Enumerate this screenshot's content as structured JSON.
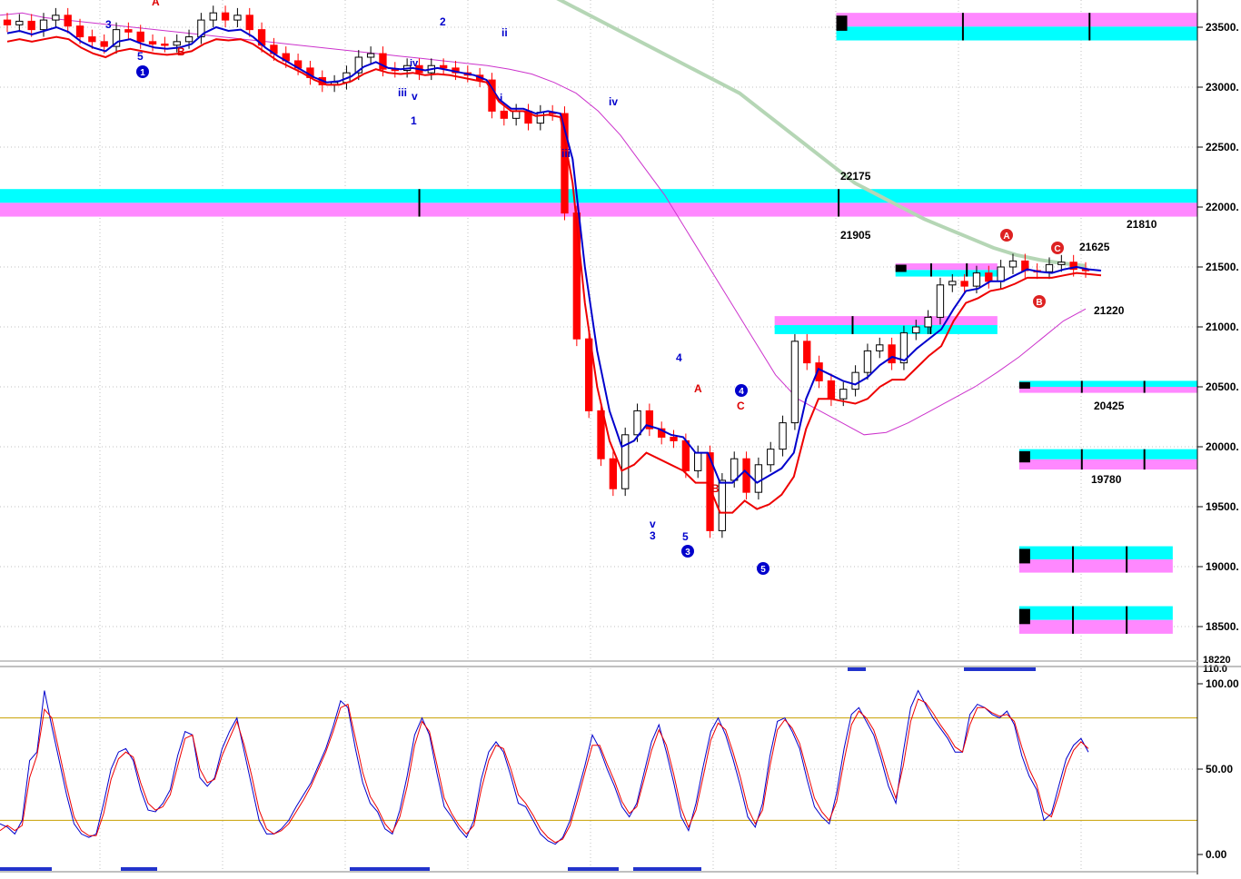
{
  "chart_data": [
    {
      "type": "candlestick",
      "ylim": [
        18220,
        23620
      ],
      "y_ticks": [
        "23500.",
        "23000.",
        "22500.",
        "22000.",
        "21500.",
        "21000.",
        "20500.",
        "20000.",
        "19500.",
        "19000.",
        "18500."
      ],
      "y_min_label": "18220",
      "grid": "dotted",
      "colors": {
        "up": "#000000",
        "down": "#ff0000",
        "blue_band": "#0000cc",
        "red_band": "#ee0000",
        "ma_slow": "#b5d6b5",
        "ma_mid": "#cc33cc",
        "cyan": "#00ffff",
        "magenta": "#ff88ff",
        "label_blue": "#0000cc",
        "label_red": "#dd0000"
      },
      "zones": [
        {
          "x0": 0.6739,
          "x1": 0.9654,
          "y_top": 23620,
          "y_bottom": 23390,
          "order": "magenta-cyan"
        },
        {
          "x0": 0.0,
          "x1": 0.9654,
          "y_top": 22150,
          "y_bottom": 21920,
          "order": "cyan-magenta"
        },
        {
          "x0": 0.7216,
          "x1": 0.8037,
          "y_top": 21530,
          "y_bottom": 21420,
          "order": "magenta-cyan"
        },
        {
          "x0": 0.6242,
          "x1": 0.8037,
          "y_top": 21090,
          "y_bottom": 20940,
          "order": "magenta-cyan"
        },
        {
          "x0": 0.8213,
          "x1": 0.9654,
          "y_top": 20550,
          "y_bottom": 20450,
          "order": "cyan-magenta"
        },
        {
          "x0": 0.8213,
          "x1": 0.9654,
          "y_top": 19980,
          "y_bottom": 19810,
          "order": "cyan-magenta"
        },
        {
          "x0": 0.8213,
          "x1": 0.945,
          "y_top": 19170,
          "y_bottom": 18950,
          "order": "cyan-magenta"
        },
        {
          "x0": 0.8213,
          "x1": 0.945,
          "y_top": 18670,
          "y_bottom": 18440,
          "order": "cyan-magenta"
        }
      ],
      "level_labels": [
        "22175",
        "21905",
        "21810",
        "21625",
        "21220",
        "20425",
        "19780"
      ],
      "wave_labels": {
        "blue_text": [
          "3",
          "5",
          "2",
          "iv",
          "v",
          "iii",
          "1",
          "ii",
          "i",
          "iv",
          "iii",
          "4",
          "v",
          "3",
          "5"
        ],
        "red_text": [
          "A",
          "B",
          "A",
          "C",
          "B"
        ],
        "blue_circles": [
          "1",
          "3",
          "4",
          "5"
        ],
        "red_circles": [
          "A",
          "C",
          "B"
        ]
      },
      "close_series": [
        23520,
        23550,
        23480,
        23560,
        23600,
        23510,
        23420,
        23380,
        23340,
        23480,
        23460,
        23380,
        23360,
        23350,
        23380,
        23420,
        23560,
        23620,
        23560,
        23600,
        23480,
        23350,
        23280,
        23220,
        23160,
        23080,
        23020,
        23040,
        23120,
        23250,
        23280,
        23150,
        23140,
        23180,
        23120,
        23180,
        23160,
        23120,
        23100,
        23060,
        22800,
        22740,
        22800,
        22700,
        22790,
        22780,
        21950,
        20900,
        20300,
        19900,
        19650,
        20100,
        20300,
        20150,
        20080,
        20050,
        19800,
        19950,
        19300,
        19720,
        19900,
        19620,
        19850,
        19980,
        20200,
        20880,
        20700,
        20550,
        20400,
        20480,
        20620,
        20800,
        20850,
        20700,
        20950,
        21000,
        21080,
        21350,
        21380,
        21340,
        21450,
        21380,
        21500,
        21550,
        21470,
        21460,
        21520,
        21540,
        21480,
        21470
      ],
      "fast_band": [
        23450,
        23470,
        23440,
        23470,
        23500,
        23460,
        23380,
        23330,
        23300,
        23380,
        23400,
        23360,
        23330,
        23320,
        23330,
        23360,
        23450,
        23500,
        23470,
        23480,
        23420,
        23330,
        23260,
        23200,
        23140,
        23080,
        23040,
        23050,
        23090,
        23170,
        23210,
        23160,
        23150,
        23160,
        23140,
        23160,
        23140,
        23120,
        23100,
        23060,
        22900,
        22820,
        22820,
        22780,
        22800,
        22780,
        22400,
        21500,
        20800,
        20300,
        20000,
        20050,
        20180,
        20150,
        20100,
        20080,
        19950,
        19950,
        19700,
        19700,
        19800,
        19700,
        19760,
        19820,
        19950,
        20400,
        20650,
        20600,
        20550,
        20520,
        20580,
        20680,
        20750,
        20720,
        20820,
        20900,
        20980,
        21150,
        21300,
        21320,
        21380,
        21380,
        21430,
        21480,
        21460,
        21450,
        21480,
        21500,
        21480,
        21470
      ],
      "slow_band": [
        23380,
        23400,
        23380,
        23400,
        23420,
        23400,
        23330,
        23280,
        23250,
        23300,
        23320,
        23300,
        23280,
        23270,
        23280,
        23300,
        23360,
        23400,
        23390,
        23400,
        23360,
        23290,
        23220,
        23170,
        23120,
        23060,
        23020,
        23020,
        23050,
        23110,
        23150,
        23120,
        23110,
        23120,
        23100,
        23110,
        23100,
        23080,
        23060,
        23040,
        22880,
        22800,
        22800,
        22760,
        22770,
        22750,
        22200,
        21200,
        20500,
        20050,
        19800,
        19850,
        19950,
        19900,
        19850,
        19800,
        19700,
        19700,
        19450,
        19450,
        19550,
        19480,
        19520,
        19600,
        19750,
        20150,
        20400,
        20400,
        20380,
        20360,
        20400,
        20500,
        20560,
        20560,
        20660,
        20760,
        20840,
        21050,
        21200,
        21240,
        21300,
        21320,
        21360,
        21410,
        21410,
        21410,
        21430,
        21450,
        21440,
        21430
      ],
      "ma_mid": [
        23600,
        23620,
        23580,
        23560,
        23540,
        23520,
        23500,
        23480,
        23460,
        23440,
        23420,
        23400,
        23380,
        23360,
        23340,
        23320,
        23300,
        23280,
        23260,
        23240,
        23220,
        23200,
        23180,
        23150,
        23110,
        23040,
        22950,
        22800,
        22600,
        22350,
        22100,
        21800,
        21500,
        21200,
        20900,
        20600,
        20400,
        20300,
        20200,
        20100,
        20120,
        20200,
        20300,
        20400,
        20500,
        20620,
        20750,
        20900,
        21050,
        21150
      ],
      "ma_slow": [
        23950,
        23850,
        23750,
        23650,
        23550,
        23450,
        23350,
        23250,
        23150,
        23050,
        22950,
        22800,
        22650,
        22500,
        22350,
        22200,
        22100,
        22000,
        21900,
        21820,
        21740,
        21660,
        21600,
        21560,
        21530,
        21510
      ]
    },
    {
      "type": "line",
      "ylim": [
        0,
        110
      ],
      "y_ticks": [
        "100.00",
        "50.00",
        "0.00"
      ],
      "y_top_label": "110.0",
      "ref_lines": [
        80,
        20
      ],
      "series": [
        {
          "color": "#0000cc",
          "values": [
            18,
            16,
            12,
            20,
            55,
            60,
            96,
            75,
            55,
            35,
            18,
            12,
            10,
            12,
            30,
            50,
            60,
            62,
            55,
            38,
            26,
            25,
            30,
            38,
            58,
            72,
            70,
            45,
            40,
            45,
            62,
            72,
            80,
            60,
            40,
            20,
            12,
            12,
            15,
            20,
            28,
            35,
            42,
            52,
            62,
            75,
            90,
            86,
            62,
            42,
            30,
            25,
            15,
            12,
            26,
            46,
            70,
            80,
            70,
            48,
            28,
            22,
            15,
            10,
            20,
            44,
            60,
            66,
            60,
            46,
            30,
            28,
            20,
            12,
            8,
            6,
            10,
            20,
            36,
            52,
            70,
            62,
            50,
            40,
            28,
            22,
            30,
            48,
            66,
            76,
            60,
            42,
            22,
            14,
            30,
            52,
            72,
            80,
            70,
            56,
            40,
            22,
            16,
            30,
            58,
            78,
            80,
            72,
            62,
            44,
            28,
            22,
            18,
            36,
            62,
            82,
            86,
            78,
            70,
            56,
            40,
            30,
            60,
            86,
            96,
            88,
            80,
            74,
            68,
            60,
            60,
            82,
            88,
            86,
            82,
            80,
            84,
            76,
            58,
            46,
            38,
            20,
            24,
            40,
            56,
            64,
            68,
            60
          ]
        },
        {
          "color": "#ee0000",
          "values": [
            14,
            17,
            14,
            17,
            45,
            58,
            85,
            80,
            60,
            40,
            22,
            14,
            11,
            11,
            24,
            44,
            56,
            60,
            57,
            42,
            30,
            26,
            28,
            35,
            52,
            68,
            70,
            50,
            42,
            44,
            58,
            68,
            78,
            64,
            46,
            26,
            15,
            12,
            14,
            18,
            25,
            32,
            40,
            50,
            60,
            72,
            86,
            88,
            68,
            48,
            34,
            27,
            18,
            13,
            22,
            40,
            64,
            78,
            72,
            53,
            33,
            24,
            17,
            12,
            17,
            38,
            55,
            64,
            62,
            50,
            35,
            30,
            23,
            15,
            10,
            7,
            9,
            17,
            32,
            48,
            64,
            64,
            53,
            43,
            31,
            24,
            28,
            44,
            61,
            73,
            64,
            47,
            27,
            16,
            26,
            46,
            67,
            77,
            73,
            60,
            45,
            27,
            18,
            26,
            52,
            73,
            79,
            74,
            65,
            49,
            33,
            25,
            20,
            31,
            55,
            76,
            84,
            80,
            73,
            60,
            45,
            33,
            52,
            78,
            91,
            89,
            83,
            76,
            70,
            63,
            60,
            76,
            86,
            86,
            83,
            81,
            82,
            78,
            63,
            50,
            41,
            25,
            22,
            35,
            51,
            61,
            66,
            62
          ]
        }
      ],
      "markers": "blue bars"
    }
  ]
}
